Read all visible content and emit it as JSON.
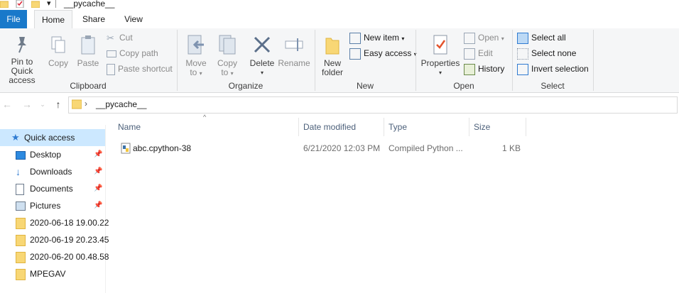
{
  "window": {
    "title": "__pycache__"
  },
  "tabs": [
    {
      "label": "File"
    },
    {
      "label": "Home"
    },
    {
      "label": "Share"
    },
    {
      "label": "View"
    }
  ],
  "ribbon": {
    "clipboard": {
      "label": "Clipboard",
      "pin": "Pin to Quick\naccess",
      "pin_l1": "Pin to Quick",
      "pin_l2": "access",
      "copy": "Copy",
      "paste": "Paste",
      "cut": "Cut",
      "copy_path": "Copy path",
      "paste_shortcut": "Paste shortcut"
    },
    "organize": {
      "label": "Organize",
      "move_l1": "Move",
      "move_l2": "to",
      "copy_l1": "Copy",
      "copy_l2": "to",
      "delete": "Delete",
      "rename": "Rename"
    },
    "new": {
      "label": "New",
      "folder_l1": "New",
      "folder_l2": "folder",
      "new_item": "New item",
      "easy_access": "Easy access"
    },
    "open": {
      "label": "Open",
      "properties": "Properties",
      "open": "Open",
      "edit": "Edit",
      "history": "History"
    },
    "select": {
      "label": "Select",
      "select_all": "Select all",
      "select_none": "Select none",
      "invert": "Invert selection"
    }
  },
  "address": {
    "path": "__pycache__"
  },
  "nav_pane": {
    "quick_access": "Quick access",
    "items": [
      {
        "label": "Desktop",
        "pinned": true
      },
      {
        "label": "Downloads",
        "pinned": true
      },
      {
        "label": "Documents",
        "pinned": true
      },
      {
        "label": "Pictures",
        "pinned": true
      },
      {
        "label": "2020-06-18 19.00.22",
        "pinned": false
      },
      {
        "label": "2020-06-19 20.23.45",
        "pinned": false
      },
      {
        "label": "2020-06-20 00.48.58",
        "pinned": false
      },
      {
        "label": "MPEGAV",
        "pinned": false
      }
    ]
  },
  "columns": {
    "name": "Name",
    "date": "Date modified",
    "type": "Type",
    "size": "Size"
  },
  "files": [
    {
      "name": "abc.cpython-38",
      "date": "6/21/2020 12:03 PM",
      "type": "Compiled Python ...",
      "size": "1 KB"
    }
  ],
  "colors": {
    "file_tab": "#1979ca",
    "selection": "#cce8ff",
    "ribbon_bg": "#f5f6f7"
  }
}
